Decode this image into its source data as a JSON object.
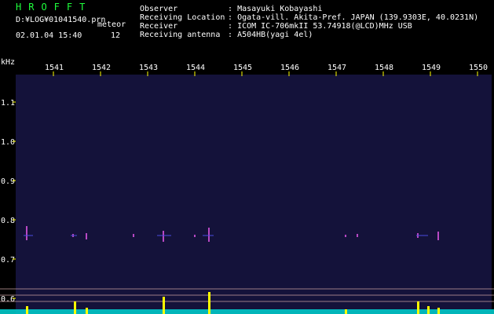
{
  "header": {
    "app_title": "HROFFT",
    "log_path": "D:¥LOG¥01041540.prn",
    "mode_label": "meteor",
    "datetime": "02.01.04 15:40",
    "count": "12"
  },
  "info": [
    {
      "label": "Observer",
      "sep": ":",
      "value": "Masayuki Kobayashi"
    },
    {
      "label": "Receiving Location",
      "sep": ":",
      "value": "Ogata-vill. Akita-Pref. JAPAN (139.9303E, 40.0231N)"
    },
    {
      "label": "Receiver",
      "sep": ":",
      "value": "ICOM IC-706mkII 53.74918(@LCD)MHz USB"
    },
    {
      "label": "Receiving antenna",
      "sep": ":",
      "value": "A504HB(yagi 4el)"
    }
  ],
  "axes": {
    "y_unit": "kHz",
    "y_ticks": [
      {
        "label": "1.1",
        "value": 1.1
      },
      {
        "label": "1.0",
        "value": 1.0
      },
      {
        "label": "0.9",
        "value": 0.9
      },
      {
        "label": "0.8",
        "value": 0.8
      },
      {
        "label": "0.7",
        "value": 0.7
      },
      {
        "label": "0.6",
        "value": 0.6
      }
    ],
    "x_ticks": [
      "1541",
      "1542",
      "1543",
      "1544",
      "1545",
      "1546",
      "1547",
      "1548",
      "1549",
      "1550"
    ]
  },
  "colors": {
    "background": "#000000",
    "waterfall": "#14123a",
    "title": "#1eff3c",
    "text": "#ffffff",
    "tick": "#ffff00",
    "signal": "#ff60ff",
    "spectrum_fill": "#00c8c8",
    "spectrum_peak": "#ffff00"
  }
}
